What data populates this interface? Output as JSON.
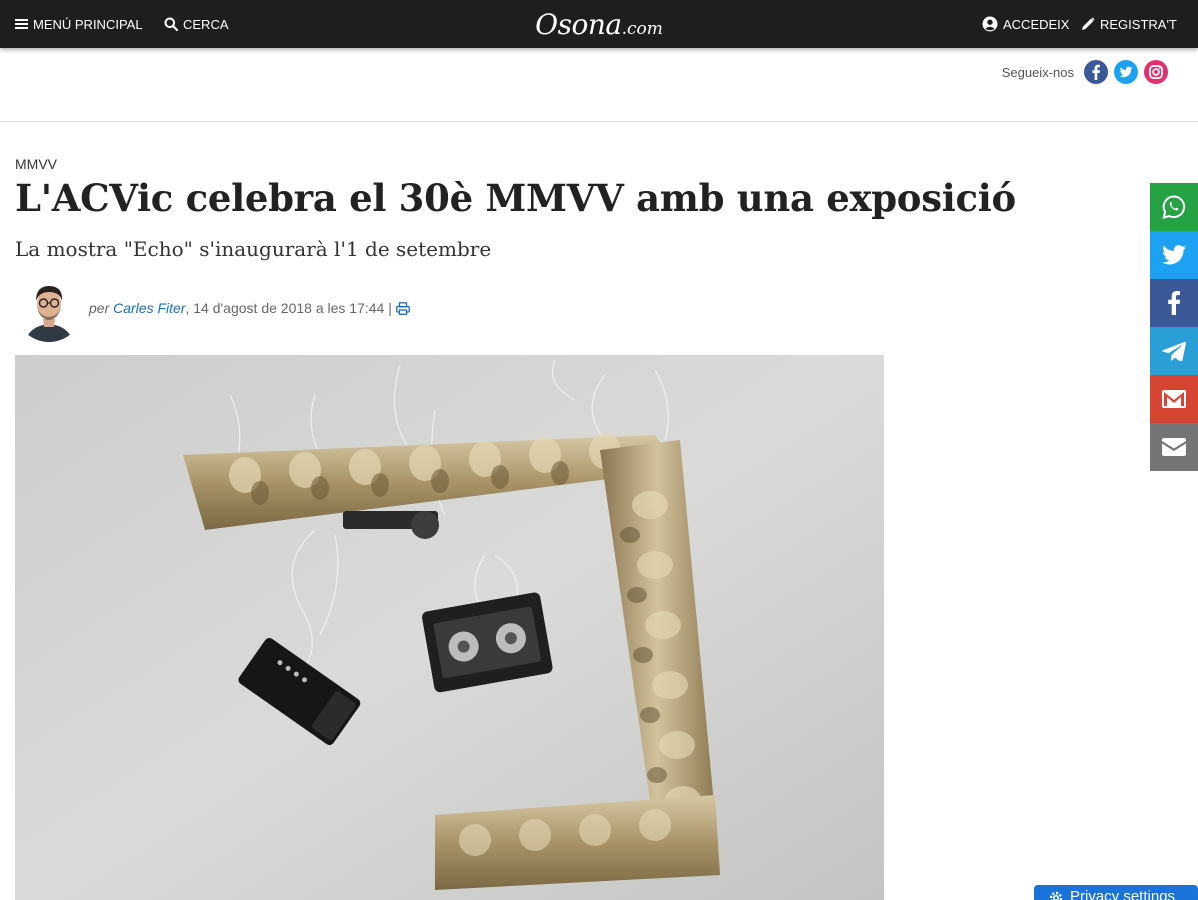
{
  "header": {
    "menu_label": "MENÚ PRINCIPAL",
    "search_label": "CERCA",
    "logo_main": "Osona",
    "logo_tld": ".com",
    "login_label": "ACCEDEIX",
    "register_label": "REGISTRA'T"
  },
  "social": {
    "follow_label": "Segueix-nos",
    "icons": [
      "facebook-icon",
      "twitter-icon",
      "instagram-icon"
    ]
  },
  "article": {
    "section": "MMVV",
    "title": "L'ACVic celebra el 30è MMVV amb una exposició",
    "subtitle": "La mostra \"Echo\" s'inaugurarà l'1 de setembre",
    "byline_prefix": "per",
    "author": "Carles Fiter",
    "date": ", 14 d'agost de 2018 a les 17:44 |",
    "print_icon": "print-icon"
  },
  "share_bar": [
    "whatsapp-icon",
    "twitter-icon",
    "facebook-icon",
    "telegram-icon",
    "gmail-icon",
    "email-icon"
  ],
  "privacy": {
    "label": "Privacy settings"
  },
  "colors": {
    "topbar": "#1e1e1e",
    "link": "#1a6fb5",
    "whatsapp": "#25a244",
    "twitter": "#1da1f2",
    "facebook": "#3b5998",
    "telegram": "#2a9fd6",
    "gmail": "#d64533",
    "email": "#757575",
    "privacy": "#1a73d8"
  }
}
